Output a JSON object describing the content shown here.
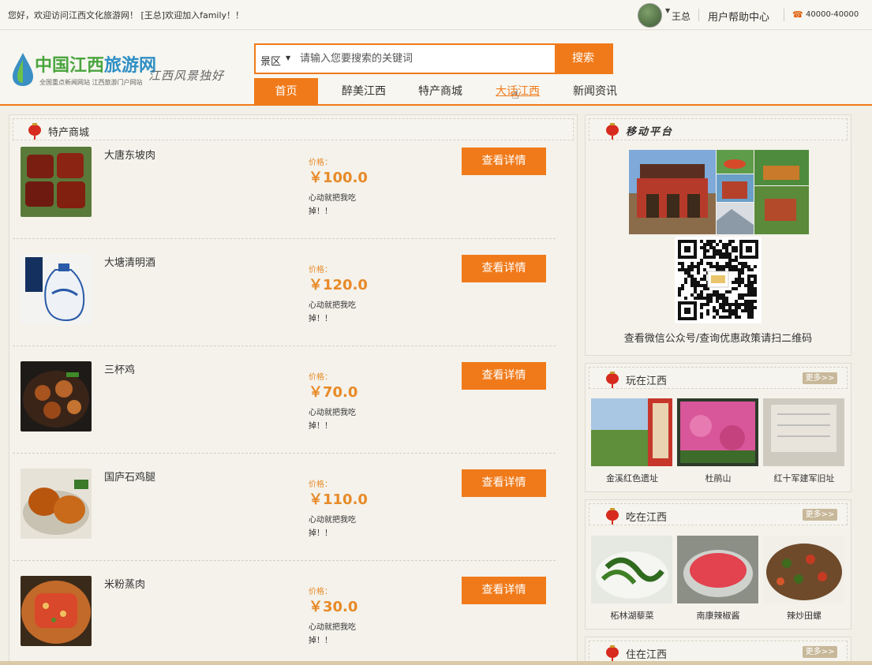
{
  "topbar": {
    "welcome": "您好，欢迎访问江西文化旅游网！ [王总]欢迎加入family！！",
    "username": "王总",
    "help": "用户帮助中心",
    "phone": "40000-40000"
  },
  "header": {
    "logo_title_a": "中国江西",
    "logo_title_b": "旅游网",
    "logo_sub": "全国重点新闻网站 江西旅游门户网站",
    "slogan": "江西风景独好",
    "search": {
      "category": "景区",
      "placeholder": "请输入您要搜索的关键词",
      "button": "搜索"
    },
    "nav": [
      "首页",
      "醉美江西",
      "特产商城",
      "大话江西",
      "新闻资讯"
    ]
  },
  "mall": {
    "title": "特产商城",
    "price_label": "价格：",
    "detail_button": "查看详情",
    "desc": "心动就把我吃掉！！",
    "products": [
      {
        "name": "大唐东坡肉",
        "price": "￥100.0"
      },
      {
        "name": "大塘清明酒",
        "price": "￥120.0"
      },
      {
        "name": "三杯鸡",
        "price": "￥70.0"
      },
      {
        "name": "国庐石鸡腿",
        "price": "￥110.0"
      },
      {
        "name": "米粉蒸肉",
        "price": "￥30.0"
      }
    ]
  },
  "mobile": {
    "title": "移动平台",
    "caption": "查看微信公众号/查询优惠政策请扫二维码"
  },
  "play": {
    "title": "玩在江西",
    "more": "更多>>",
    "items": [
      "金溪红色遗址",
      "杜鹃山",
      "红十军建军旧址"
    ]
  },
  "eat": {
    "title": "吃在江西",
    "more": "更多>>",
    "items": [
      "柘林湖藜菜",
      "南康辣椒酱",
      "辣炒田螺"
    ]
  },
  "stay": {
    "title": "住在江西",
    "more": "更多>>"
  },
  "colors": {
    "accent": "#f07a1a",
    "price": "#e88a28",
    "background": "#f1efe6"
  }
}
